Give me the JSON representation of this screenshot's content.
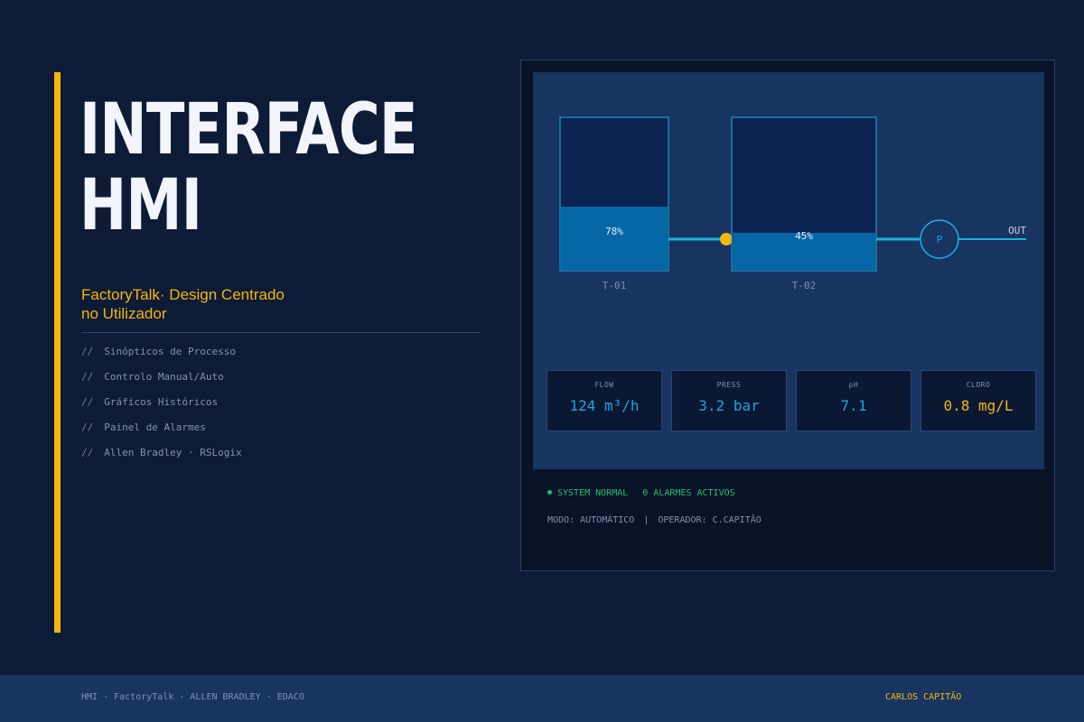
{
  "hero": {
    "title_line1": "INTERFACE",
    "title_line2": "HMI",
    "subtitle_line1": "FactoryTalk· Design Centrado",
    "subtitle_line2": "no Utilizador"
  },
  "features": [
    {
      "prefix": "//",
      "label": "Sinópticos de Processo"
    },
    {
      "prefix": "//",
      "label": "Controlo Manual/Auto"
    },
    {
      "prefix": "//",
      "label": "Gráficos Históricos"
    },
    {
      "prefix": "//",
      "label": "Painel de Alarmes"
    },
    {
      "prefix": "//",
      "label": "Allen Bradley · RSLogix"
    }
  ],
  "hmi": {
    "tanks": [
      {
        "id": "T-01",
        "level_pct": 78,
        "level_label": "78%"
      },
      {
        "id": "T-02",
        "level_pct": 45,
        "level_label": "45%"
      }
    ],
    "pump_label": "P",
    "out_label": "OUT",
    "kpis": [
      {
        "label": "FLOW",
        "value": "124 m³/h",
        "status": "normal"
      },
      {
        "label": "PRESS",
        "value": "3.2 bar",
        "status": "normal"
      },
      {
        "label": "pH",
        "value": "7.1",
        "status": "normal"
      },
      {
        "label": "CLORO",
        "value": "0.8 mg/L",
        "status": "warning"
      }
    ],
    "status": {
      "system": "SYSTEM NORMAL",
      "alarms": "0 ALARMES ACTIVOS",
      "mode": "MODO: AUTOMÁTICO",
      "separator": "|",
      "operator": "OPERADOR: C.CAPITÃO"
    }
  },
  "footer": {
    "left": "HMI · FactoryTalk · ALLEN BRADLEY · EDACO",
    "right": "CARLOS CAPITÃO"
  },
  "colors": {
    "background": "#0d1b36",
    "accent": "#f5b70d",
    "cyan": "#1aa6de",
    "status_ok": "#20c26f",
    "panel": "#183461"
  }
}
